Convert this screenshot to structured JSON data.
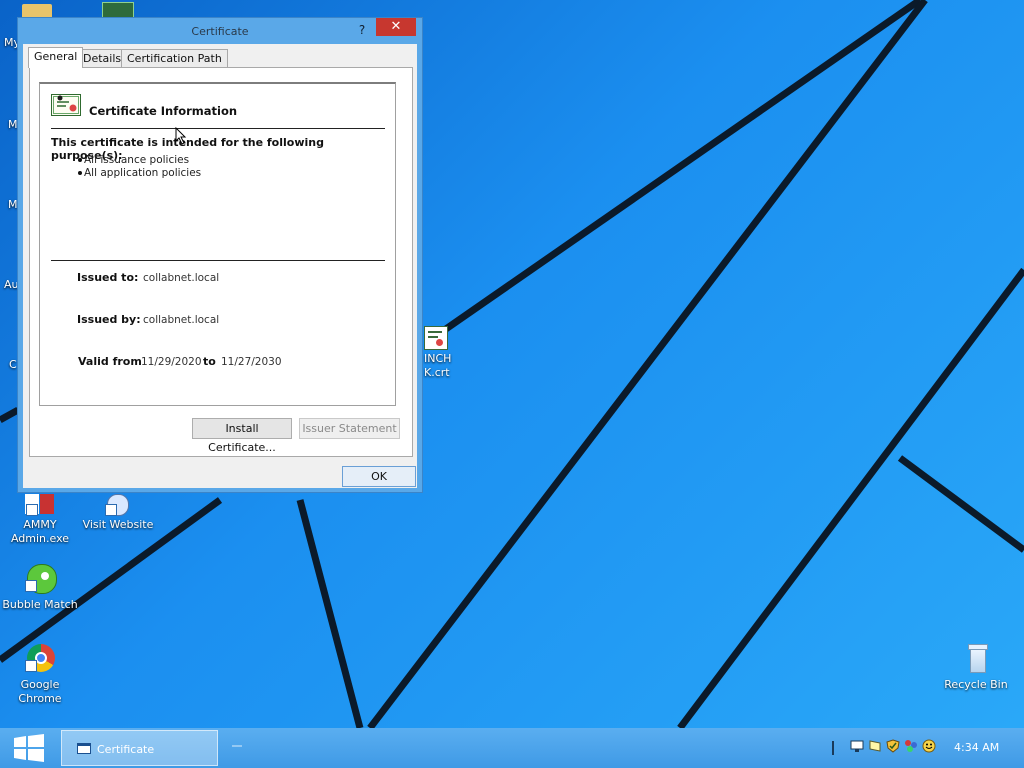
{
  "desktop": {
    "icons": [
      {
        "label": "My",
        "name": "folder"
      },
      {
        "label": "M",
        "name": "partial-left-1"
      },
      {
        "label": "M",
        "name": "partial-left-2"
      },
      {
        "label": "Au",
        "name": "partial-left-3"
      },
      {
        "label": "C",
        "name": "partial-left-4"
      },
      {
        "label": "INCH K.crt",
        "name": "cert-file"
      },
      {
        "label": "AMMY Admin.exe",
        "name": "ammy-admin"
      },
      {
        "label": "Visit Website",
        "name": "visit-website"
      },
      {
        "label": "Bubble Match",
        "name": "bubble-match"
      },
      {
        "label": "Google Chrome",
        "name": "google-chrome"
      },
      {
        "label": "Recycle Bin",
        "name": "recycle-bin"
      }
    ]
  },
  "dialog": {
    "title": "Certificate",
    "help_label": "?",
    "close_label": "✕",
    "tabs": [
      {
        "label": "General"
      },
      {
        "label": "Details"
      },
      {
        "label": "Certification Path"
      }
    ],
    "info_title": "Certificate Information",
    "purpose_heading": "This certificate is intended for the following purpose(s):",
    "purposes": [
      "All issuance policies",
      "All application policies"
    ],
    "issued_to_label": "Issued to:",
    "issued_to": "collabnet.local",
    "issued_by_label": "Issued by:",
    "issued_by": "collabnet.local",
    "valid_from_label": "Valid from",
    "valid_from": "11/29/2020",
    "to_label": "to",
    "valid_to": "11/27/2030",
    "install_button": "Install Certificate...",
    "issuer_statement_button": "Issuer Statement",
    "ok_button": "OK"
  },
  "taskbar": {
    "task_label": "Certificate",
    "clock": "4:34 AM"
  },
  "colors": {
    "desktop_blue": "#1b8ff0",
    "close_red": "#c7372f",
    "window_frame": "#5aa8e8"
  }
}
